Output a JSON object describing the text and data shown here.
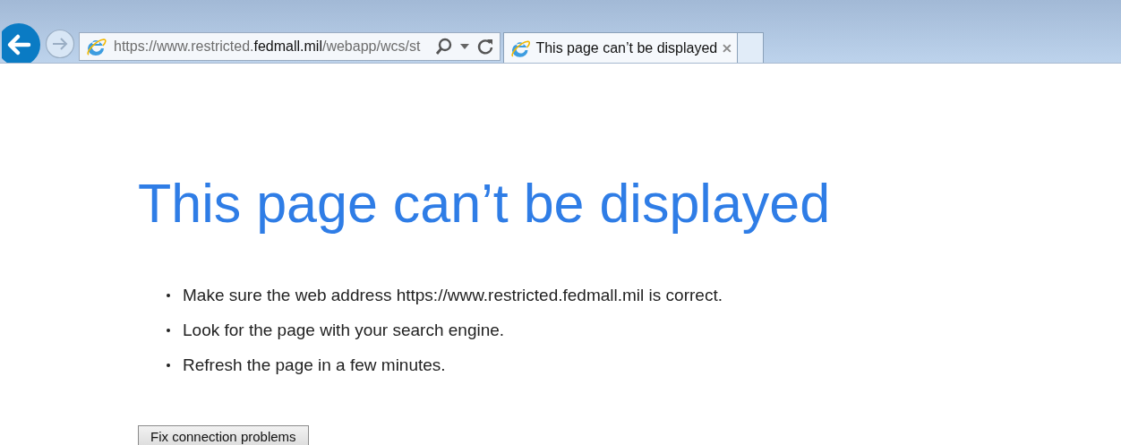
{
  "address_bar": {
    "url_prefix": "https://www.restricted.",
    "url_domain": "fedmall.mil",
    "url_path": "/webapp/wcs/st"
  },
  "tabs": [
    {
      "label": "This page can’t be displayed",
      "selected": true
    }
  ],
  "page": {
    "title": "This page can’t be displayed",
    "suggestions": [
      "Make sure the web address https://www.restricted.fedmall.mil is correct.",
      "Look for the page with your search engine.",
      "Refresh the page in a few minutes."
    ],
    "button": "Fix connection problems"
  }
}
